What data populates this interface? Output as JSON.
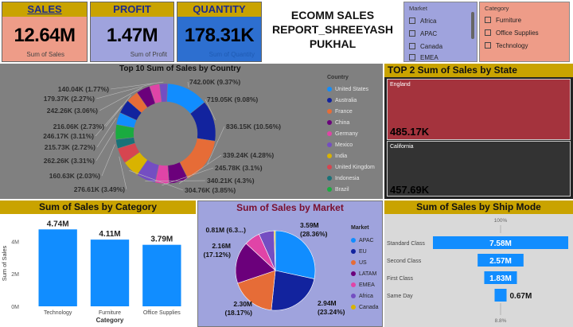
{
  "kpis": {
    "sales": {
      "label": "SALES",
      "value": "12.64M",
      "sub": "Sum of Sales",
      "bg": "#ee9c88"
    },
    "profit": {
      "label": "PROFIT",
      "value": "1.47M",
      "sub": "Sum of Profit",
      "bg": "#9fa3dd"
    },
    "quantity": {
      "label": "QUANTITY",
      "value": "178.31K",
      "sub": "Sum of Quantity",
      "bg": "#2d6fd0"
    }
  },
  "report_title": {
    "line1": "ECOMM SALES",
    "line2": "REPORT_SHREEYASH",
    "line3": "PUKHAL"
  },
  "slicers": {
    "market": {
      "title": "Market",
      "items": [
        "Africa",
        "APAC",
        "Canada",
        "EMEA"
      ]
    },
    "category": {
      "title": "Category",
      "items": [
        "Furniture",
        "Office Supplies",
        "Technology"
      ]
    }
  },
  "chart_data": [
    {
      "type": "pie",
      "title": "Top 10 Sum of Sales by Country",
      "legend_title": "Country",
      "legend_position": "right",
      "categories": [
        "United States",
        "Australia",
        "France",
        "China",
        "Germany",
        "Mexico",
        "India",
        "United Kingdom",
        "Indonesia",
        "Brazil"
      ],
      "values": [
        2297.2,
        925.24,
        858.93,
        700.56,
        628.84,
        622.59,
        589.65,
        528.58,
        404.88,
        361.11
      ],
      "colors": [
        "#118dff",
        "#12239e",
        "#e66c37",
        "#6b007b",
        "#e044a7",
        "#744ec2",
        "#d9b300",
        "#d64550",
        "#197278",
        "#1aab40"
      ],
      "data_labels": [
        "742.00K (9.37%)",
        "719.05K (9.08%)",
        "836.15K (10.56%)",
        "339.24K (4.28%)",
        "245.78K (3.1%)",
        "340.21K (4.3%)",
        "304.76K (3.85%)",
        "276.61K (3.49%)",
        "160.63K (2.03%)",
        "262.26K (3.31%)",
        "215.73K (2.72%)",
        "246.17K (3.11%)",
        "216.06K (2.73%)",
        "242.26K (3.06%)",
        "179.37K (2.27%)",
        "140.04K (1.77%)"
      ],
      "label_values": [
        742.0,
        719.05,
        836.15,
        339.24,
        245.78,
        340.21,
        304.76,
        276.61,
        160.63,
        262.26,
        215.73,
        246.17,
        216.06,
        242.26,
        179.37,
        140.04
      ]
    },
    {
      "type": "bar",
      "orientation": "horizontal",
      "title": "TOP 2 Sum of Sales by State",
      "categories": [
        "England",
        "California"
      ],
      "values": [
        485.17,
        457.69
      ],
      "value_labels": [
        "485.17K",
        "457.69K"
      ],
      "colors": [
        "#a4333d",
        "#333333"
      ]
    },
    {
      "type": "bar",
      "title": "Sum of Sales by Category",
      "categories": [
        "Technology",
        "Furniture",
        "Office Supplies"
      ],
      "values": [
        4.74,
        4.11,
        3.79
      ],
      "value_labels": [
        "4.74M",
        "4.11M",
        "3.79M"
      ],
      "xlabel": "Category",
      "ylabel": "Sum of Sales",
      "ylim": [
        0,
        5
      ],
      "yticks": [
        0,
        2,
        4
      ],
      "ytick_labels": [
        "0M",
        "2M",
        "4M"
      ],
      "color": "#118dff"
    },
    {
      "type": "pie",
      "title": "Sum of Sales by Market",
      "legend_title": "Market",
      "legend_position": "right",
      "categories": [
        "APAC",
        "EU",
        "US",
        "LATAM",
        "EMEA",
        "Africa",
        "Canada"
      ],
      "values": [
        3.59,
        2.94,
        2.3,
        2.16,
        0.81,
        0.78,
        0.07
      ],
      "colors": [
        "#118dff",
        "#12239e",
        "#e66c37",
        "#6b007b",
        "#e044a7",
        "#744ec2",
        "#d9b300"
      ],
      "data_labels": [
        "3.59M (28.36%)",
        "2.94M (23.24%)",
        "2.30M (18.17%)",
        "2.16M (17.12%)",
        "0.81M (6.3...)"
      ]
    },
    {
      "type": "bar",
      "subtype": "funnel",
      "title": "Sum of Sales by Ship Mode",
      "categories": [
        "Standard Class",
        "Second Class",
        "First Class",
        "Same Day"
      ],
      "values": [
        7.58,
        2.57,
        1.83,
        0.67
      ],
      "value_labels": [
        "7.58M",
        "2.57M",
        "1.83M",
        "0.67M"
      ],
      "top_label": "100%",
      "bottom_label": "8.8%",
      "color": "#118dff"
    }
  ]
}
